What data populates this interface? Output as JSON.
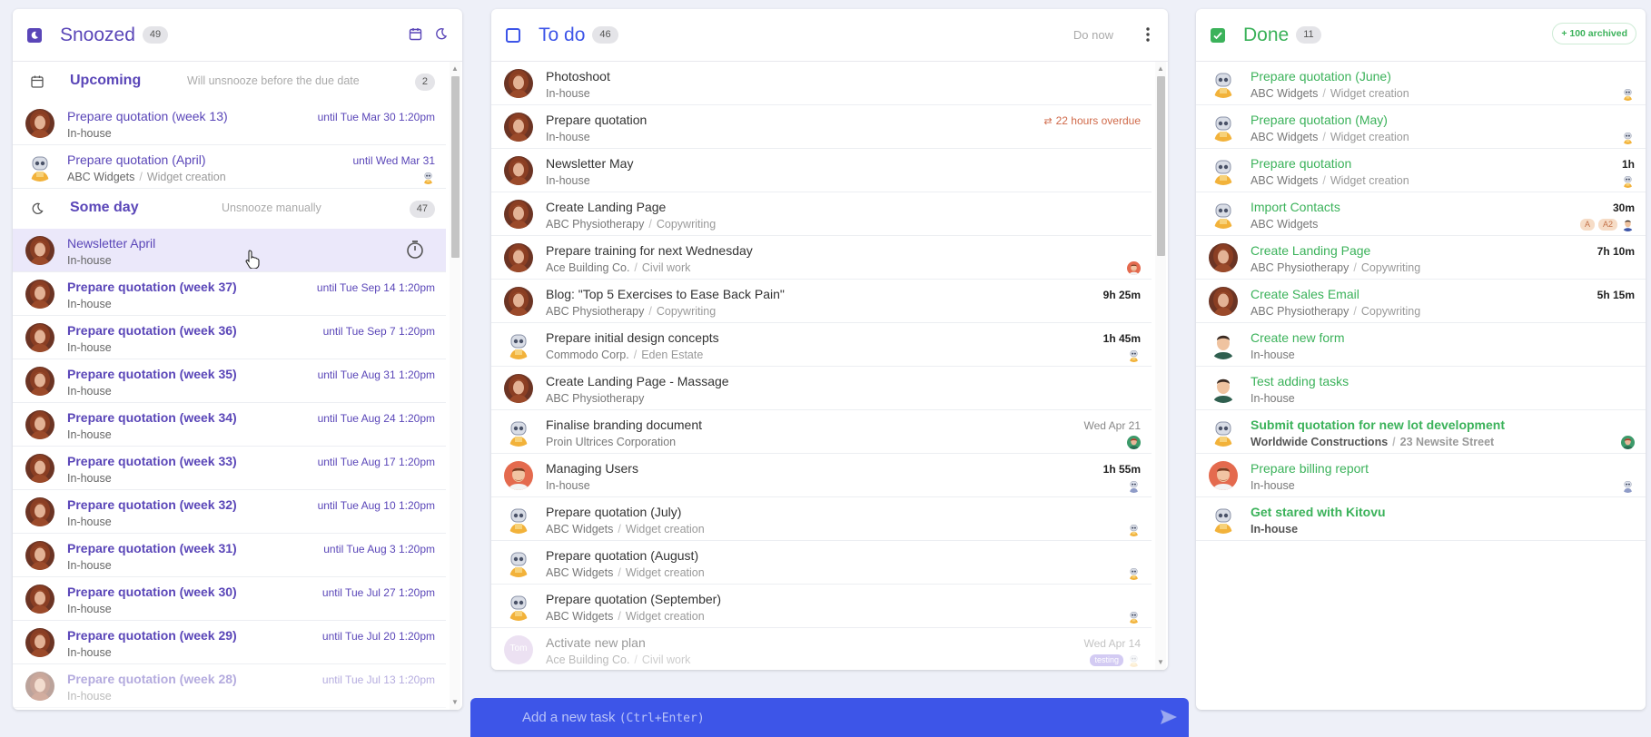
{
  "snoozed": {
    "title": "Snoozed",
    "count": "49",
    "upcoming": {
      "title": "Upcoming",
      "desc": "Will unsnooze before the due date",
      "count": "2"
    },
    "upcoming_items": [
      {
        "title": "Prepare quotation (week 13)",
        "project": "In-house",
        "sub": "",
        "until": "until Tue Mar 30 1:20pm",
        "avatar": "woman",
        "mini": ""
      },
      {
        "title": "Prepare quotation (April)",
        "project": "ABC Widgets",
        "sub": "Widget creation",
        "until": "until Wed Mar 31",
        "avatar": "robot",
        "mini": "robot"
      }
    ],
    "someday": {
      "title": "Some day",
      "desc": "Unsnooze manually",
      "count": "47"
    },
    "someday_items": [
      {
        "title": "Newsletter April",
        "project": "In-house",
        "sub": "",
        "until": "",
        "avatar": "woman",
        "bold": false,
        "hover": true
      },
      {
        "title": "Prepare quotation (week 37)",
        "project": "In-house",
        "sub": "",
        "until": "until Tue Sep 14 1:20pm",
        "avatar": "woman",
        "bold": true
      },
      {
        "title": "Prepare quotation (week 36)",
        "project": "In-house",
        "sub": "",
        "until": "until Tue Sep 7 1:20pm",
        "avatar": "woman",
        "bold": true
      },
      {
        "title": "Prepare quotation (week 35)",
        "project": "In-house",
        "sub": "",
        "until": "until Tue Aug 31 1:20pm",
        "avatar": "woman",
        "bold": true
      },
      {
        "title": "Prepare quotation (week 34)",
        "project": "In-house",
        "sub": "",
        "until": "until Tue Aug 24 1:20pm",
        "avatar": "woman",
        "bold": true
      },
      {
        "title": "Prepare quotation (week 33)",
        "project": "In-house",
        "sub": "",
        "until": "until Tue Aug 17 1:20pm",
        "avatar": "woman",
        "bold": true
      },
      {
        "title": "Prepare quotation (week 32)",
        "project": "In-house",
        "sub": "",
        "until": "until Tue Aug 10 1:20pm",
        "avatar": "woman",
        "bold": true
      },
      {
        "title": "Prepare quotation (week 31)",
        "project": "In-house",
        "sub": "",
        "until": "until Tue Aug 3 1:20pm",
        "avatar": "woman",
        "bold": true
      },
      {
        "title": "Prepare quotation (week 30)",
        "project": "In-house",
        "sub": "",
        "until": "until Tue Jul 27 1:20pm",
        "avatar": "woman",
        "bold": true
      },
      {
        "title": "Prepare quotation (week 29)",
        "project": "In-house",
        "sub": "",
        "until": "until Tue Jul 20 1:20pm",
        "avatar": "woman",
        "bold": true
      },
      {
        "title": "Prepare quotation (week 28)",
        "project": "In-house",
        "sub": "",
        "until": "until Tue Jul 13 1:20pm",
        "avatar": "woman",
        "bold": true,
        "faded": true
      }
    ]
  },
  "todo": {
    "title": "To do",
    "count": "46",
    "do_now": "Do now",
    "items": [
      {
        "title": "Photoshoot",
        "project": "In-house",
        "sub": "",
        "right": "",
        "rightclass": "",
        "avatar": "woman",
        "mini": []
      },
      {
        "title": "Prepare quotation",
        "project": "In-house",
        "sub": "",
        "right": "22 hours overdue",
        "rightclass": "overdue",
        "avatar": "woman",
        "mini": []
      },
      {
        "title": "Newsletter May",
        "project": "In-house",
        "sub": "",
        "right": "",
        "rightclass": "",
        "avatar": "woman",
        "mini": []
      },
      {
        "title": "Create Landing Page",
        "project": "ABC Physiotherapy",
        "sub": "Copywriting",
        "right": "",
        "rightclass": "",
        "avatar": "woman",
        "mini": []
      },
      {
        "title": "Prepare training for next Wednesday",
        "project": "Ace Building Co.",
        "sub": "Civil work",
        "right": "",
        "rightclass": "",
        "avatar": "woman",
        "mini": [
          "man"
        ]
      },
      {
        "title": "Blog: \"Top 5 Exercises to Ease Back Pain\"",
        "project": "ABC Physiotherapy",
        "sub": "Copywriting",
        "right": "9h 25m",
        "rightclass": "bold",
        "avatar": "woman",
        "mini": []
      },
      {
        "title": "Prepare initial design concepts",
        "project": "Commodo Corp.",
        "sub": "Eden Estate",
        "right": "1h 45m",
        "rightclass": "bold",
        "avatar": "robot",
        "mini": [
          "robot"
        ]
      },
      {
        "title": "Create Landing Page - Massage",
        "project": "ABC Physiotherapy",
        "sub": "",
        "right": "",
        "rightclass": "",
        "avatar": "woman",
        "mini": []
      },
      {
        "title": "Finalise branding document",
        "project": "Proin Ultrices Corporation",
        "sub": "",
        "right": "Wed Apr 21",
        "rightclass": "date",
        "avatar": "robot",
        "mini": [
          "green"
        ]
      },
      {
        "title": "Managing Users",
        "project": "In-house",
        "sub": "",
        "right": "1h 55m",
        "rightclass": "bold",
        "avatar": "man",
        "mini": [
          "robotblue"
        ]
      },
      {
        "title": "Prepare quotation (July)",
        "project": "ABC Widgets",
        "sub": "Widget creation",
        "right": "",
        "rightclass": "",
        "avatar": "robot",
        "mini": [
          "robot"
        ]
      },
      {
        "title": "Prepare quotation (August)",
        "project": "ABC Widgets",
        "sub": "Widget creation",
        "right": "",
        "rightclass": "",
        "avatar": "robot",
        "mini": [
          "robot"
        ]
      },
      {
        "title": "Prepare quotation (September)",
        "project": "ABC Widgets",
        "sub": "Widget creation",
        "right": "",
        "rightclass": "",
        "avatar": "robot",
        "mini": [
          "robot"
        ]
      },
      {
        "title": "Activate new plan",
        "project": "Ace Building Co.",
        "sub": "Civil work",
        "right": "Wed Apr 14",
        "rightclass": "date",
        "avatar": "tom",
        "avatar_text": "Tom",
        "mini": [
          "tag:testing",
          "robotfaded"
        ],
        "faded": true
      }
    ]
  },
  "done": {
    "title": "Done",
    "count": "11",
    "archived": "+ 100 archived",
    "items": [
      {
        "title": "Prepare quotation (June)",
        "project": "ABC Widgets",
        "sub": "Widget creation",
        "right": "",
        "avatar": "robot",
        "mini": [
          "robot"
        ],
        "bold": false
      },
      {
        "title": "Prepare quotation (May)",
        "project": "ABC Widgets",
        "sub": "Widget creation",
        "right": "",
        "avatar": "robot",
        "mini": [
          "robot"
        ],
        "bold": false
      },
      {
        "title": "Prepare quotation",
        "project": "ABC Widgets",
        "sub": "Widget creation",
        "right": "1h",
        "avatar": "robot",
        "mini": [
          "robot"
        ],
        "bold": false
      },
      {
        "title": "Import Contacts",
        "project": "ABC Widgets",
        "sub": "",
        "right": "30m",
        "avatar": "robot",
        "mini": [
          "tag:A",
          "tag:A2",
          "manblue"
        ],
        "bold": false
      },
      {
        "title": "Create Landing Page",
        "project": "ABC Physiotherapy",
        "sub": "Copywriting",
        "right": "7h 10m",
        "avatar": "woman",
        "mini": [],
        "bold": false
      },
      {
        "title": "Create Sales Email",
        "project": "ABC Physiotherapy",
        "sub": "Copywriting",
        "right": "5h 15m",
        "avatar": "woman",
        "mini": [],
        "bold": false
      },
      {
        "title": "Create new form",
        "project": "In-house",
        "sub": "",
        "right": "",
        "avatar": "mangreen",
        "mini": [],
        "bold": false
      },
      {
        "title": "Test adding tasks",
        "project": "In-house",
        "sub": "",
        "right": "",
        "avatar": "mangreen",
        "mini": [],
        "bold": false
      },
      {
        "title": "Submit quotation for new lot development",
        "project": "Worldwide Constructions",
        "sub": "23 Newsite Street",
        "right": "",
        "avatar": "robot",
        "mini": [
          "green"
        ],
        "bold": true
      },
      {
        "title": "Prepare billing report",
        "project": "In-house",
        "sub": "",
        "right": "",
        "avatar": "man",
        "mini": [
          "robotblue"
        ],
        "bold": false
      },
      {
        "title": "Get stared with Kitovu",
        "project": "In-house",
        "sub": "",
        "right": "",
        "avatar": "robot",
        "mini": [],
        "bold": true
      }
    ]
  },
  "addbar": {
    "placeholder": "Add a new task",
    "shortcut": "(Ctrl+Enter)"
  },
  "colors": {
    "snoozed": "#5a46b8",
    "todo": "#3d55e8",
    "done": "#3bb25a",
    "overdue": "#d06a4a",
    "addbar": "#3d55e8"
  },
  "icons": {
    "snoozed": "moon-icon",
    "todo": "checkbox-empty-icon",
    "done": "checkbox-checked-icon",
    "upcoming": "calendar-icon",
    "someday": "moon-icon",
    "timer": "stopwatch-icon",
    "send": "send-icon",
    "more": "kebab-menu-icon",
    "repeat": "repeat-icon"
  }
}
